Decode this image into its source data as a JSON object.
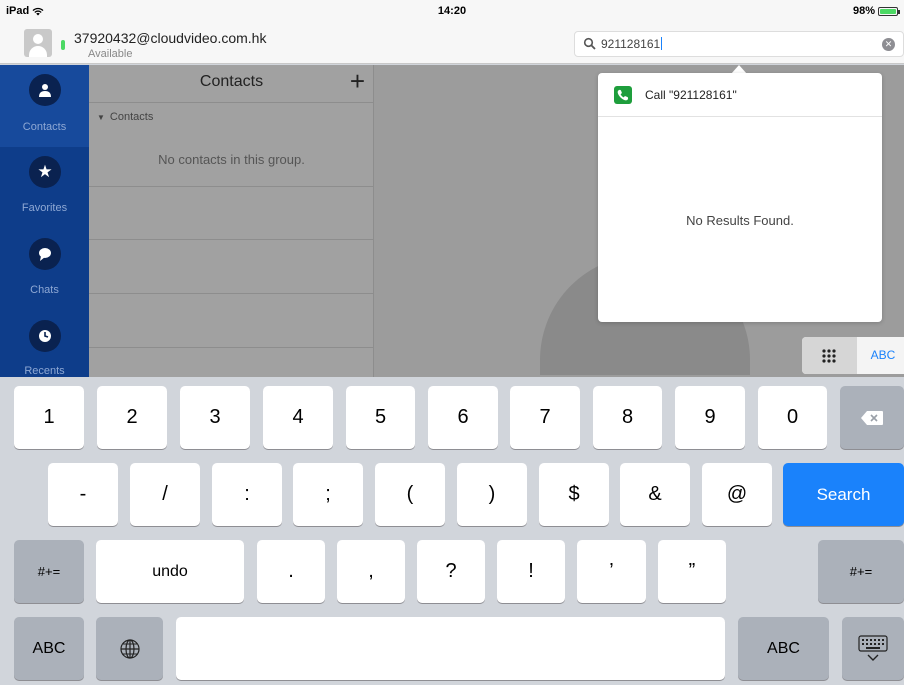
{
  "status_bar": {
    "device": "iPad",
    "time": "14:20",
    "battery": "98%"
  },
  "header": {
    "account": "37920432@cloudvideo.com.hk",
    "presence": "Available",
    "search_value": "921128161"
  },
  "sidebar": {
    "items": [
      {
        "label": "Contacts",
        "icon": "person-icon"
      },
      {
        "label": "Favorites",
        "icon": "star-icon"
      },
      {
        "label": "Chats",
        "icon": "chat-bubble-icon"
      },
      {
        "label": "Recents",
        "icon": "clock-icon"
      }
    ]
  },
  "contacts_pane": {
    "title": "Contacts",
    "add_label": "+",
    "group_name": "Contacts",
    "empty_text": "No contacts in this group."
  },
  "search_popover": {
    "call_label": "Call \"921128161\"",
    "no_results": "No Results Found."
  },
  "keypad_toggle": {
    "abc_label": "ABC"
  },
  "keyboard": {
    "row1": [
      "1",
      "2",
      "3",
      "4",
      "5",
      "6",
      "7",
      "8",
      "9",
      "0"
    ],
    "row2": [
      "-",
      "/",
      ":",
      ";",
      "(",
      ")",
      "$",
      "&",
      "@"
    ],
    "search_label": "Search",
    "row3_left": "#+=",
    "undo_label": "undo",
    "row3": [
      ".",
      ",",
      "?",
      "!",
      "’",
      "”"
    ],
    "row3_right": "#+=",
    "abc_left": "ABC",
    "abc_right": "ABC"
  },
  "colors": {
    "accent": "#1a82fb",
    "sidebar": "#0e3d8a",
    "presence": "#4cd964",
    "call_green": "#1e9e3c"
  }
}
